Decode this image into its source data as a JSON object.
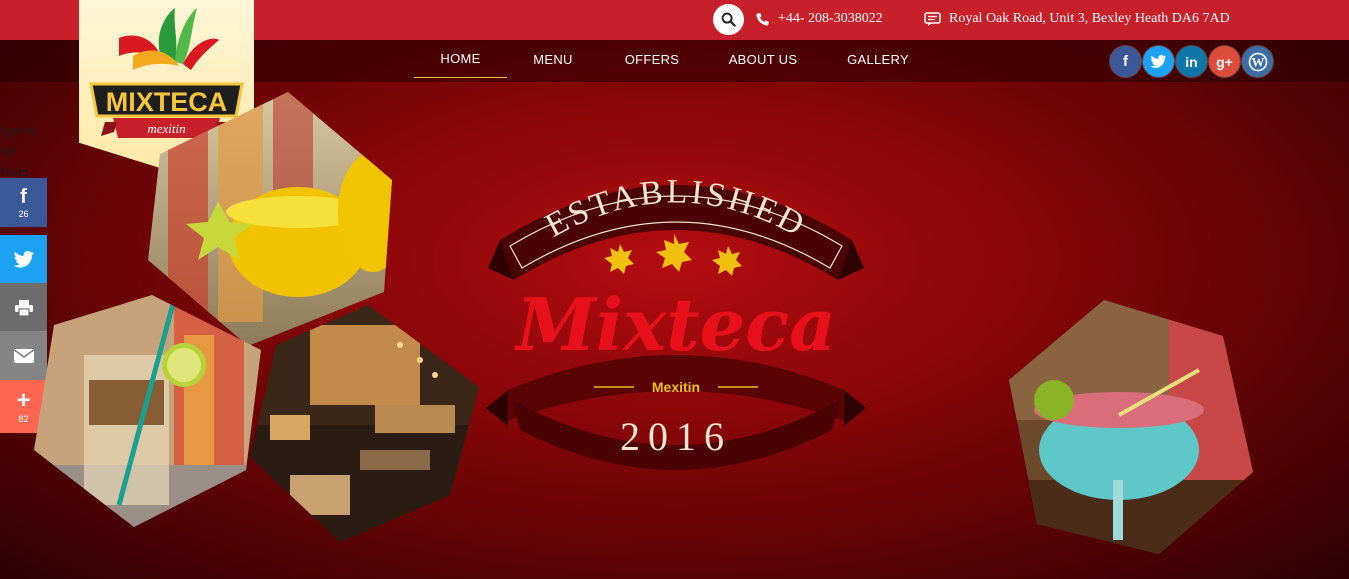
{
  "header": {
    "phone": "+44- 208-3038022",
    "address": "Royal Oak Road, Unit 3, Bexley Heath DA6 7AD"
  },
  "logo": {
    "name": "MIXTECA",
    "tagline": "mexitin"
  },
  "nav": {
    "items": [
      {
        "label": "HOME",
        "active": true
      },
      {
        "label": "MENU",
        "active": false
      },
      {
        "label": "OFFERS",
        "active": false
      },
      {
        "label": "ABOUT US",
        "active": false
      },
      {
        "label": "GALLERY",
        "active": false
      }
    ]
  },
  "social": [
    {
      "icon": "facebook-icon",
      "color": "#3b5998",
      "glyph": "f"
    },
    {
      "icon": "twitter-icon",
      "color": "#1da1f2",
      "glyph": "t"
    },
    {
      "icon": "linkedin-icon",
      "color": "#0e76a8",
      "glyph": "in"
    },
    {
      "icon": "googleplus-icon",
      "color": "#dd4b39",
      "glyph": "g+"
    },
    {
      "icon": "wordpress-icon",
      "color": "#3a6ea5",
      "glyph": "W"
    }
  ],
  "share": {
    "label": "Spread the Word",
    "buttons": [
      {
        "icon": "facebook-icon",
        "color": "#3b5998",
        "count": "26"
      },
      {
        "icon": "twitter-icon",
        "color": "#1da1f2",
        "count": ""
      },
      {
        "icon": "print-icon",
        "color": "#6d6d6d",
        "count": ""
      },
      {
        "icon": "email-icon",
        "color": "#848484",
        "count": ""
      },
      {
        "icon": "plus-icon",
        "color": "#ff6550",
        "count": "82"
      }
    ]
  },
  "emblem": {
    "top_text": "ESTABLISHED",
    "script_name": "Mixteca",
    "subtitle": "Mexitin",
    "year": "2016"
  },
  "colors": {
    "topbar": "#c8202a",
    "gold": "#e8c53b",
    "script_red": "#e8101a"
  }
}
